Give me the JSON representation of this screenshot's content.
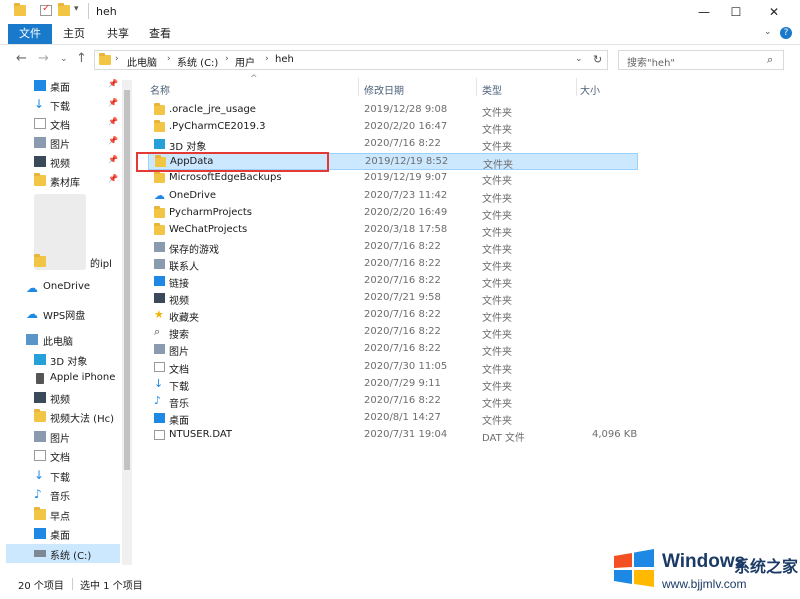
{
  "window": {
    "title": "heh",
    "controls": {
      "minimize": "—",
      "maximize": "☐",
      "close": "✕"
    }
  },
  "ribbon": {
    "tabs": [
      "文件",
      "主页",
      "共享",
      "查看"
    ],
    "expand_icon": "chevron-down-icon",
    "help": "?"
  },
  "address": {
    "crumbs": [
      "此电脑",
      "系统 (C:)",
      "用户",
      "heh"
    ],
    "search_placeholder": "搜索\"heh\""
  },
  "nav": {
    "quick_access": [
      {
        "label": "桌面",
        "icon": "desktop-icon",
        "pinned": true
      },
      {
        "label": "下载",
        "icon": "download-icon",
        "pinned": true
      },
      {
        "label": "文档",
        "icon": "document-icon",
        "pinned": true
      },
      {
        "label": "图片",
        "icon": "picture-icon",
        "pinned": true
      },
      {
        "label": "视频",
        "icon": "video-icon",
        "pinned": true
      },
      {
        "label": "素材库",
        "icon": "folder-icon",
        "pinned": true
      }
    ],
    "partial_item": "的ipl",
    "onedrive": "OneDrive",
    "wps": "WPS网盘",
    "this_pc": "此电脑",
    "pc_items": [
      {
        "label": "3D 对象",
        "icon": "cube-icon"
      },
      {
        "label": "Apple iPhone",
        "icon": "phone-icon"
      },
      {
        "label": "视频",
        "icon": "video-icon"
      },
      {
        "label": "视频大法 (Hc)",
        "icon": "folder-icon"
      },
      {
        "label": "图片",
        "icon": "picture-icon"
      },
      {
        "label": "文档",
        "icon": "document-icon"
      },
      {
        "label": "下载",
        "icon": "download-icon"
      },
      {
        "label": "音乐",
        "icon": "music-icon"
      },
      {
        "label": "早点",
        "icon": "folder-icon"
      },
      {
        "label": "桌面",
        "icon": "desktop-icon"
      },
      {
        "label": "系统 (C:)",
        "icon": "drive-icon"
      }
    ]
  },
  "columns": {
    "name": "名称",
    "date": "修改日期",
    "type": "类型",
    "size": "大小"
  },
  "files": [
    {
      "name": ".oracle_jre_usage",
      "date": "2019/12/28 9:08",
      "type": "文件夹",
      "size": "",
      "icon": "folder-icon"
    },
    {
      "name": ".PyCharmCE2019.3",
      "date": "2020/2/20 16:47",
      "type": "文件夹",
      "size": "",
      "icon": "folder-icon"
    },
    {
      "name": "3D 对象",
      "date": "2020/7/16 8:22",
      "type": "文件夹",
      "size": "",
      "icon": "cube-icon"
    },
    {
      "name": "AppData",
      "date": "2019/12/19 8:52",
      "type": "文件夹",
      "size": "",
      "icon": "folder-icon"
    },
    {
      "name": "MicrosoftEdgeBackups",
      "date": "2019/12/19 9:07",
      "type": "文件夹",
      "size": "",
      "icon": "folder-icon"
    },
    {
      "name": "OneDrive",
      "date": "2020/7/23 11:42",
      "type": "文件夹",
      "size": "",
      "icon": "cloud-icon"
    },
    {
      "name": "PycharmProjects",
      "date": "2020/2/20 16:49",
      "type": "文件夹",
      "size": "",
      "icon": "folder-icon"
    },
    {
      "name": "WeChatProjects",
      "date": "2020/3/18 17:58",
      "type": "文件夹",
      "size": "",
      "icon": "folder-icon"
    },
    {
      "name": "保存的游戏",
      "date": "2020/7/16 8:22",
      "type": "文件夹",
      "size": "",
      "icon": "saved-games-icon"
    },
    {
      "name": "联系人",
      "date": "2020/7/16 8:22",
      "type": "文件夹",
      "size": "",
      "icon": "contacts-icon"
    },
    {
      "name": "链接",
      "date": "2020/7/16 8:22",
      "type": "文件夹",
      "size": "",
      "icon": "link-icon"
    },
    {
      "name": "视频",
      "date": "2020/7/21 9:58",
      "type": "文件夹",
      "size": "",
      "icon": "video-icon"
    },
    {
      "name": "收藏夹",
      "date": "2020/7/16 8:22",
      "type": "文件夹",
      "size": "",
      "icon": "star-icon"
    },
    {
      "name": "搜索",
      "date": "2020/7/16 8:22",
      "type": "文件夹",
      "size": "",
      "icon": "search-icon"
    },
    {
      "name": "图片",
      "date": "2020/7/16 8:22",
      "type": "文件夹",
      "size": "",
      "icon": "picture-icon"
    },
    {
      "name": "文档",
      "date": "2020/7/30 11:05",
      "type": "文件夹",
      "size": "",
      "icon": "document-icon"
    },
    {
      "name": "下载",
      "date": "2020/7/29 9:11",
      "type": "文件夹",
      "size": "",
      "icon": "download-icon"
    },
    {
      "name": "音乐",
      "date": "2020/7/16 8:22",
      "type": "文件夹",
      "size": "",
      "icon": "music-icon"
    },
    {
      "name": "桌面",
      "date": "2020/8/1 14:27",
      "type": "文件夹",
      "size": "",
      "icon": "desktop-icon"
    },
    {
      "name": "NTUSER.DAT",
      "date": "2020/7/31 19:04",
      "type": "DAT 文件",
      "size": "4,096 KB",
      "icon": "file-icon"
    }
  ],
  "status": {
    "count": "20 个项目",
    "selected": "选中 1 个项目"
  },
  "watermark": {
    "brand": "Windows",
    "cn": "系统之家",
    "url": "www.bjjmlv.com"
  },
  "colors": {
    "accent": "#1979ca",
    "selection": "#cce8ff",
    "highlight": "#e53935"
  }
}
